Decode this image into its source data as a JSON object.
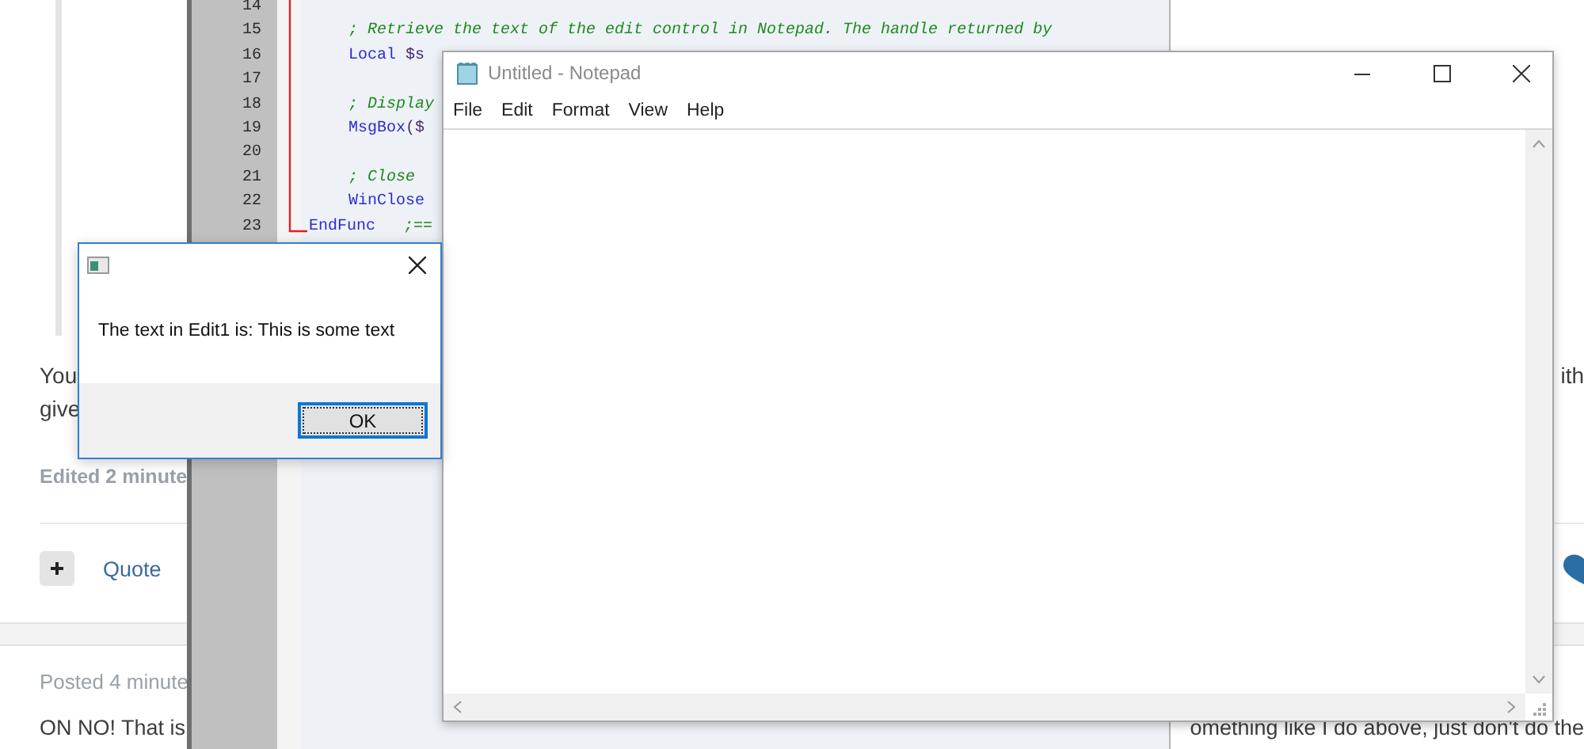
{
  "forum": {
    "post_lines": [
      {
        "left": "You",
        "right": "ith"
      },
      {
        "left": "give"
      }
    ],
    "edited_note": "Edited 2 minute",
    "quote_link": "Quote",
    "next_post": {
      "posted": "Posted 4 minute",
      "text_left": "ON NO! That is",
      "text_right": "omething like I do above, just don't do the"
    }
  },
  "code_editor": {
    "lines": [
      {
        "number": "14"
      },
      {
        "number": "15",
        "indented": true,
        "tokens": [
          {
            "text": "; Retrieve the text of the edit control in Notepad. The handle returned by",
            "kind": "comment"
          }
        ]
      },
      {
        "number": "16",
        "indented": true,
        "tokens": [
          {
            "text": "Local",
            "kind": "keyword"
          },
          {
            "text": " $s",
            "kind": "variable"
          }
        ]
      },
      {
        "number": "17"
      },
      {
        "number": "18",
        "indented": true,
        "tokens": [
          {
            "text": "; Display",
            "kind": "comment"
          }
        ]
      },
      {
        "number": "19",
        "indented": true,
        "tokens": [
          {
            "text": "MsgBox",
            "kind": "keyword"
          },
          {
            "text": "($",
            "kind": "variable"
          }
        ]
      },
      {
        "number": "20"
      },
      {
        "number": "21",
        "indented": true,
        "tokens": [
          {
            "text": "; Close",
            "kind": "comment"
          }
        ]
      },
      {
        "number": "22",
        "indented": true,
        "tokens": [
          {
            "text": "WinClose",
            "kind": "keyword"
          }
        ]
      },
      {
        "number": "23",
        "indented": false,
        "tokens": [
          {
            "text": "EndFunc",
            "kind": "keyword"
          },
          {
            "text": "   ;==",
            "kind": "comment"
          }
        ]
      }
    ]
  },
  "notepad": {
    "title": "Untitled - Notepad",
    "menu": [
      "File",
      "Edit",
      "Format",
      "View",
      "Help"
    ]
  },
  "message_box": {
    "text": "The text in Edit1 is: This is some text",
    "button": "OK"
  }
}
